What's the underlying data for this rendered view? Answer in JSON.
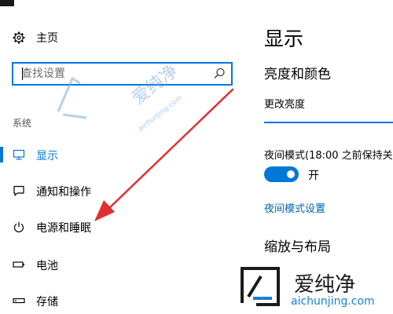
{
  "nav": {
    "home_label": "主页",
    "search": {
      "placeholder": "查找设置"
    },
    "section_label": "系统",
    "items": [
      {
        "label": "显示",
        "icon": "monitor-icon",
        "active": true
      },
      {
        "label": "通知和操作",
        "icon": "message-icon",
        "active": false
      },
      {
        "label": "电源和睡眠",
        "icon": "power-icon",
        "active": false
      },
      {
        "label": "电池",
        "icon": "battery-icon",
        "active": false
      },
      {
        "label": "存储",
        "icon": "storage-icon",
        "active": false
      }
    ]
  },
  "content": {
    "title": "显示",
    "brightness_section": "亮度和颜色",
    "brightness_label": "更改亮度",
    "night_light_label": "夜间模式(18:00 之前保持关",
    "night_light_toggle": {
      "state_label": "开",
      "on": true
    },
    "night_light_link": "夜间模式设置",
    "scale_section": "缩放与布局"
  },
  "watermark": {
    "name": "爱纯净",
    "url": "aichunjing.com"
  },
  "colors": {
    "accent": "#0078d7",
    "link": "#0063b1",
    "annotation_arrow": "#e03030"
  }
}
